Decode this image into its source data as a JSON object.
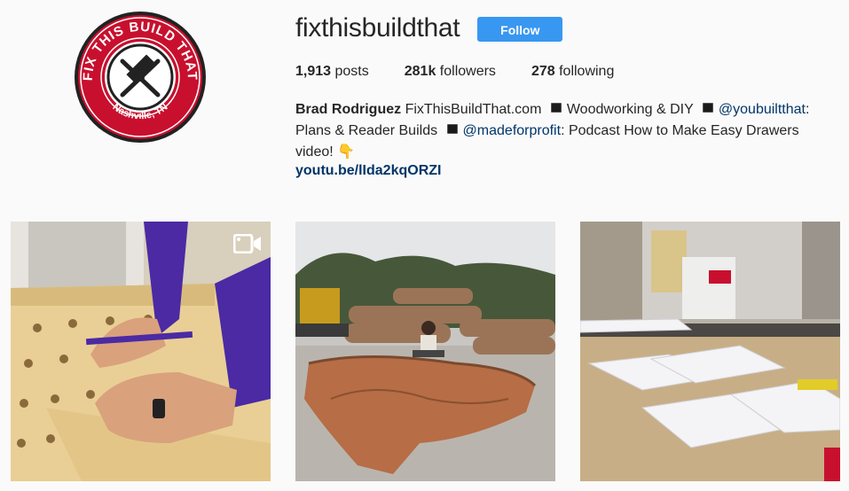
{
  "profile": {
    "username": "fixthisbuildthat",
    "follow_label": "Follow",
    "avatar": {
      "brand_text": "FIX THIS BUILD THAT",
      "location_text": "Nashville, TN",
      "color": "#c8102e"
    }
  },
  "stats": {
    "posts_count": "1,913",
    "posts_label": "posts",
    "followers_count": "281k",
    "followers_label": "followers",
    "following_count": "278",
    "following_label": "following"
  },
  "bio": {
    "name": "Brad Rodriguez",
    "site": "FixThisBuildThat.com",
    "topic": "Woodworking & DIY",
    "mention1": "@youbuiltthat",
    "text1": ": Plans & Reader Builds",
    "mention2": "@madeforprofit",
    "text2": ": Podcast How to Make Easy Drawers video!",
    "emoji": "👇",
    "link": "youtu.be/lIda2kqORZI"
  },
  "posts": [
    {
      "type": "video",
      "icon": "video-camera-icon"
    },
    {
      "type": "image"
    },
    {
      "type": "image"
    }
  ]
}
